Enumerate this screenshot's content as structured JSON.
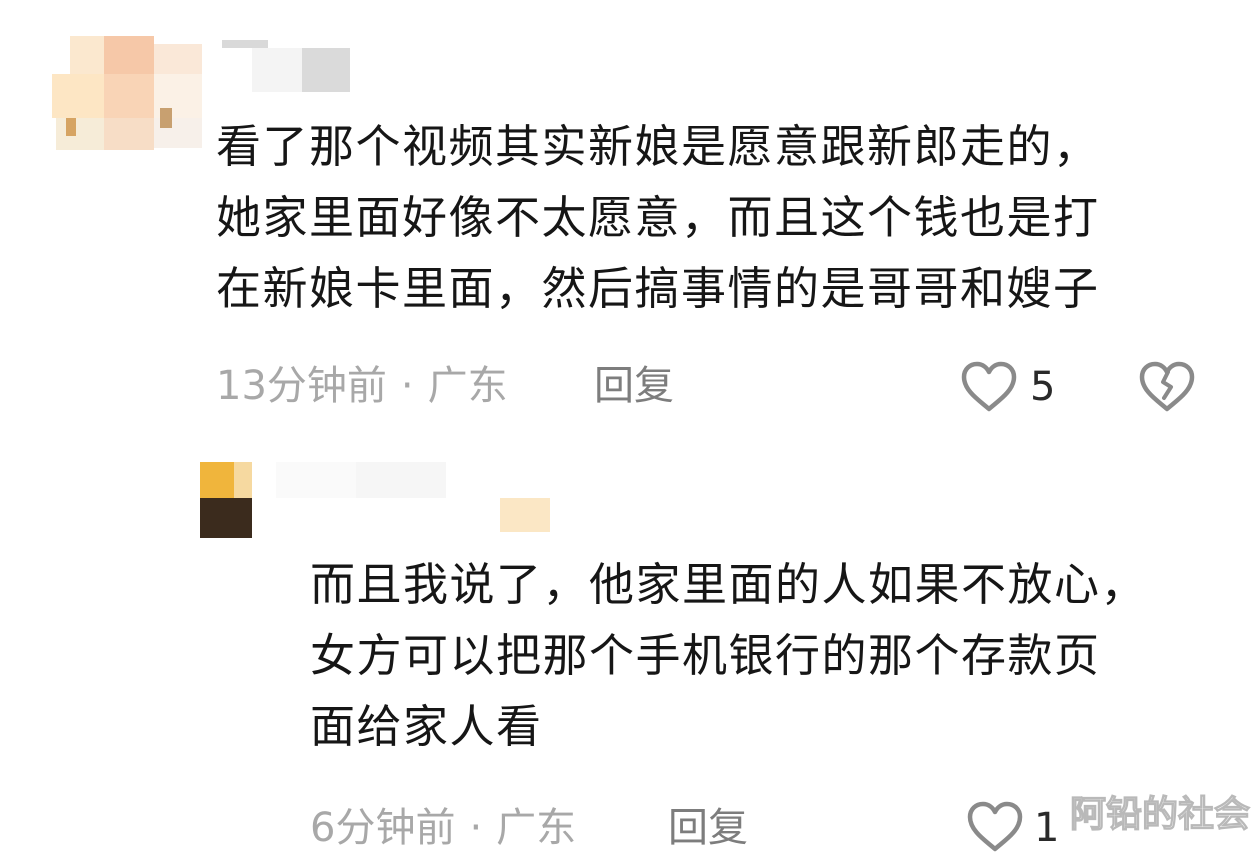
{
  "comments": [
    {
      "lines": [
        "看了那个视频其实新娘是愿意跟新郎走的，",
        "她家里面好像不太愿意，而且这个钱也是打",
        "在新娘卡里面，然后搞事情的是哥哥和嫂子"
      ],
      "time": "13分钟前",
      "separator": "·",
      "region": "广东",
      "reply_label": "回复",
      "like_count": "5"
    },
    {
      "lines": [
        "而且我说了，他家里面的人如果不放心，",
        "女方可以把那个手机银行的那个存款页",
        "面给家人看"
      ],
      "time": "6分钟前",
      "separator": "·",
      "region": "广东",
      "reply_label": "回复",
      "like_count": "1"
    }
  ],
  "watermark": "阿铅的社会",
  "icons": {
    "like": "heart-outline-icon",
    "dislike": "broken-heart-icon",
    "avatar": "pixelated-avatar"
  },
  "colors": {
    "text": "#161616",
    "meta": "#a8a8a8",
    "reply": "#7d7d7d",
    "icon": "#8a8a8a"
  }
}
